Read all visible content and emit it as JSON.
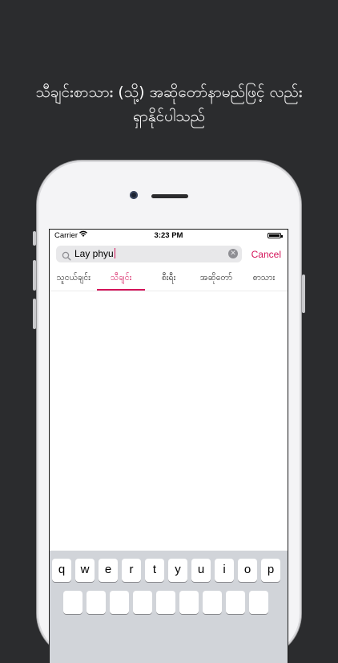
{
  "headline": {
    "line1": "သီချင်းစာသား (သို့) အဆိုတော်နာမည်ဖြင့် လည်း",
    "line2": "ရှာနိုင်ပါသည်"
  },
  "status_bar": {
    "carrier": "Carrier",
    "time": "3:23 PM"
  },
  "search": {
    "value": "Lay phyu",
    "cancel_label": "Cancel"
  },
  "tabs": [
    {
      "label": "သူငယ်ချင်း",
      "active": false
    },
    {
      "label": "သီချင်း",
      "active": true
    },
    {
      "label": "စီးရီး",
      "active": false
    },
    {
      "label": "အဆိုတော်",
      "active": false
    },
    {
      "label": "စာသား",
      "active": false
    }
  ],
  "keyboard": {
    "row1": [
      "q",
      "w",
      "e",
      "r",
      "t",
      "y",
      "u",
      "i",
      "o",
      "p"
    ]
  },
  "colors": {
    "accent": "#d4145a",
    "background": "#2b2c2e"
  },
  "icons": [
    "search-icon",
    "clear-icon",
    "wifi-icon",
    "battery-icon"
  ]
}
